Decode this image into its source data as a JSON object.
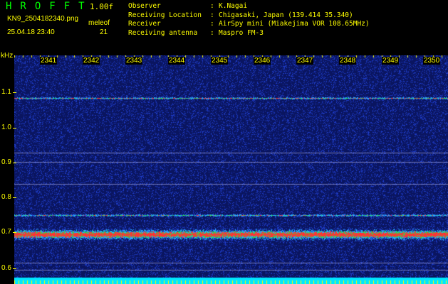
{
  "header": {
    "app_title": "HROFFT",
    "version": "1.00f",
    "filename": "KN9_2504182340.png",
    "meleof_label": "meleof",
    "datetime": "25.04.18 23:40",
    "meleof_value": "21",
    "meta": [
      {
        "key": "Observer",
        "value": "K.Nagai"
      },
      {
        "key": "Receiving Location",
        "value": "Chigasaki, Japan (139.414 35.340)"
      },
      {
        "key": "Receiver",
        "value": "AirSpy mini (Miakejima VOR 108.65MHz)"
      },
      {
        "key": "Receiving antenna",
        "value": "Maspro FM-3"
      }
    ]
  },
  "axis": {
    "y_unit": "kHz",
    "y_ticks": [
      "1.1",
      "1.0",
      "0.9",
      "0.8",
      "0.7",
      "0.6"
    ],
    "x_ticks": [
      "2341",
      "2342",
      "2343",
      "2344",
      "2345",
      "2346",
      "2347",
      "2348",
      "2349",
      "2350"
    ]
  },
  "colors": {
    "text": "#ffff00",
    "title": "#00ff00",
    "background": "#0a1560",
    "signal_band": "#ff3030"
  }
}
